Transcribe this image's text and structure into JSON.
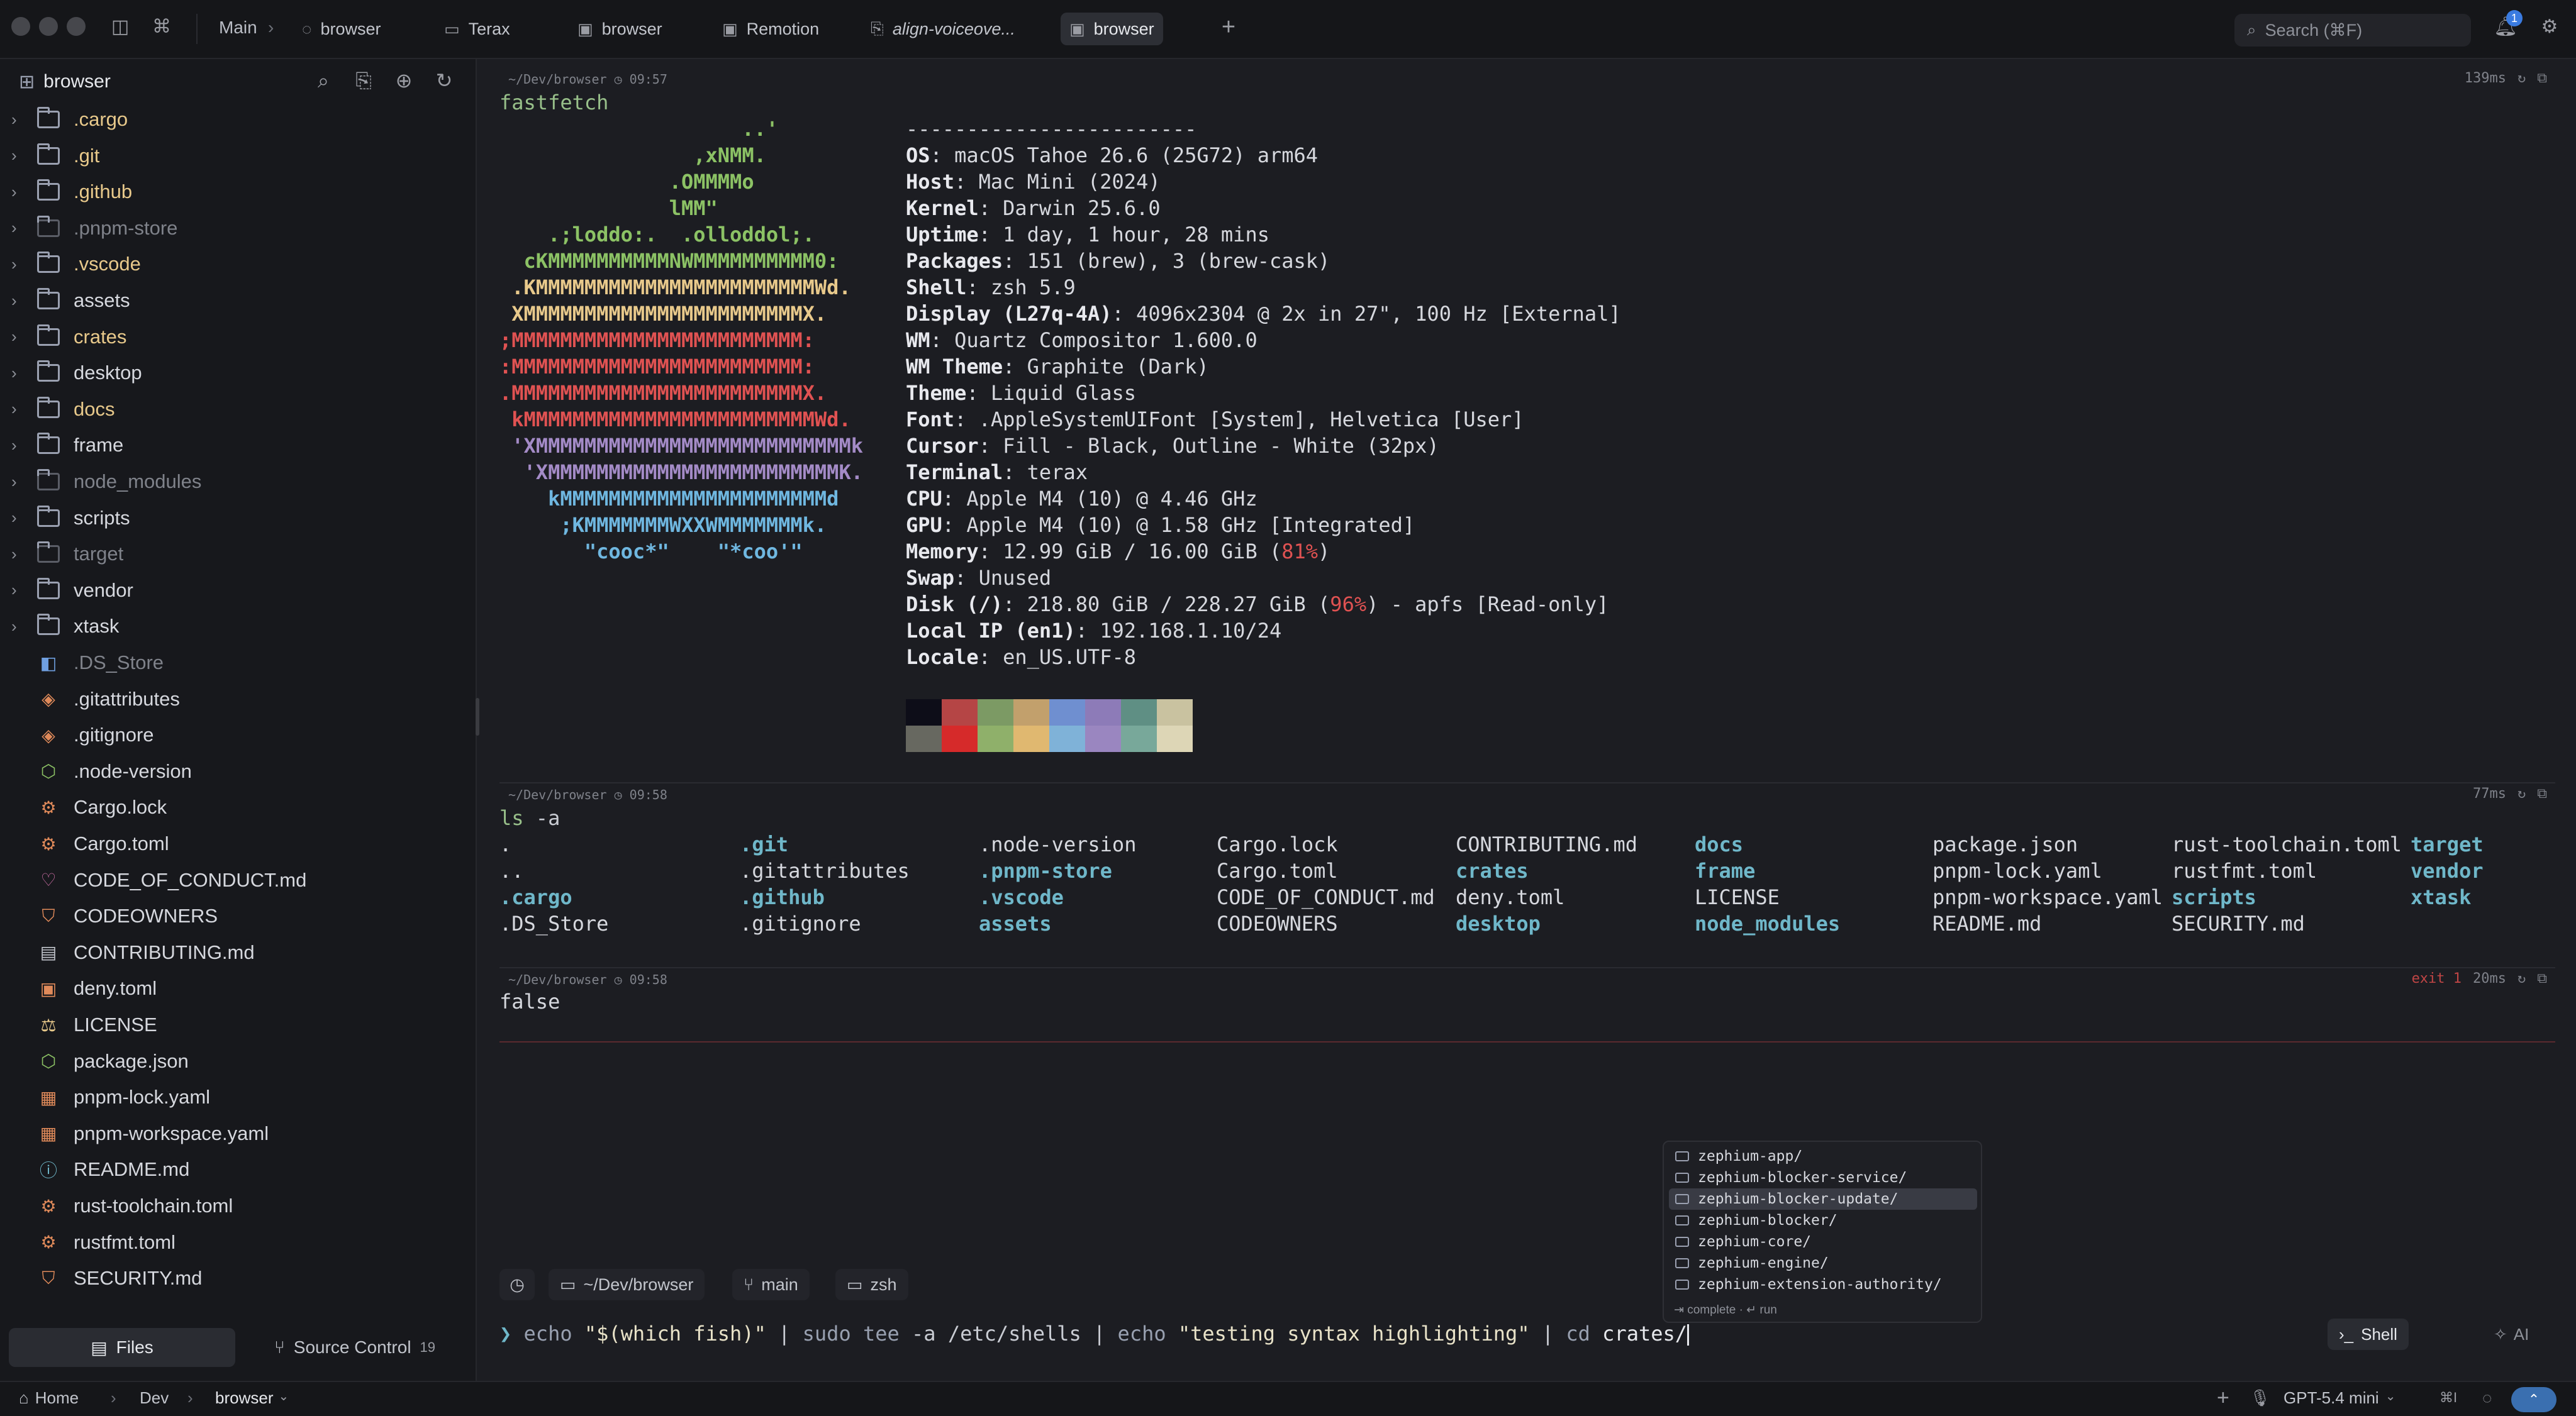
{
  "titlebar": {
    "breadcrumb": "Main",
    "tabs": [
      {
        "label": "browser",
        "icon": "chat-icon"
      },
      {
        "label": "Terax",
        "icon": "terminal-icon"
      },
      {
        "label": "browser",
        "icon": "browser-icon"
      },
      {
        "label": "Remotion",
        "icon": "browser-icon"
      },
      {
        "label": "align-voiceove...",
        "icon": "file-icon"
      },
      {
        "label": "browser",
        "icon": "browser-icon",
        "active": true
      }
    ],
    "search_placeholder": "Search (⌘F)",
    "notification_count": "1"
  },
  "sidebar": {
    "title": "browser",
    "items": [
      {
        "name": ".cargo",
        "kind": "folder",
        "color": "#e8c98b"
      },
      {
        "name": ".git",
        "kind": "folder",
        "color": "#e8c98b"
      },
      {
        "name": ".github",
        "kind": "folder",
        "color": "#e8c98b"
      },
      {
        "name": ".pnpm-store",
        "kind": "folder",
        "color": "#7f828a"
      },
      {
        "name": ".vscode",
        "kind": "folder",
        "color": "#e8c98b"
      },
      {
        "name": "assets",
        "kind": "folder",
        "color": "#d6d8de"
      },
      {
        "name": "crates",
        "kind": "folder",
        "color": "#e8c98b"
      },
      {
        "name": "desktop",
        "kind": "folder",
        "color": "#d6d8de"
      },
      {
        "name": "docs",
        "kind": "folder",
        "color": "#e8c98b"
      },
      {
        "name": "frame",
        "kind": "folder",
        "color": "#d6d8de"
      },
      {
        "name": "node_modules",
        "kind": "folder",
        "color": "#7f828a"
      },
      {
        "name": "scripts",
        "kind": "folder",
        "color": "#d6d8de"
      },
      {
        "name": "target",
        "kind": "folder",
        "color": "#7f828a"
      },
      {
        "name": "vendor",
        "kind": "folder",
        "color": "#d6d8de"
      },
      {
        "name": "xtask",
        "kind": "folder",
        "color": "#d6d8de"
      },
      {
        "name": ".DS_Store",
        "kind": "file",
        "color": "#7f828a",
        "icon": "◧",
        "icolor": "#6f9fe0"
      },
      {
        "name": ".gitattributes",
        "kind": "file",
        "color": "#d6d8de",
        "icon": "◈",
        "icolor": "#e08a5a"
      },
      {
        "name": ".gitignore",
        "kind": "file",
        "color": "#d6d8de",
        "icon": "◈",
        "icolor": "#e08a5a"
      },
      {
        "name": ".node-version",
        "kind": "file",
        "color": "#d6d8de",
        "icon": "⬡",
        "icolor": "#8cc265"
      },
      {
        "name": "Cargo.lock",
        "kind": "file",
        "color": "#d6d8de",
        "icon": "⚙",
        "icolor": "#e08a5a"
      },
      {
        "name": "Cargo.toml",
        "kind": "file",
        "color": "#d6d8de",
        "icon": "⚙",
        "icolor": "#e08a5a"
      },
      {
        "name": "CODE_OF_CONDUCT.md",
        "kind": "file",
        "color": "#d6d8de",
        "icon": "♡",
        "icolor": "#d070a8"
      },
      {
        "name": "CODEOWNERS",
        "kind": "file",
        "color": "#d6d8de",
        "icon": "⛉",
        "icolor": "#e08a5a"
      },
      {
        "name": "CONTRIBUTING.md",
        "kind": "file",
        "color": "#d6d8de",
        "icon": "▤",
        "icolor": "#c2c5cc"
      },
      {
        "name": "deny.toml",
        "kind": "file",
        "color": "#d6d8de",
        "icon": "▣",
        "icolor": "#e08a5a"
      },
      {
        "name": "LICENSE",
        "kind": "file",
        "color": "#d6d8de",
        "icon": "⚖",
        "icolor": "#e8c98b"
      },
      {
        "name": "package.json",
        "kind": "file",
        "color": "#d6d8de",
        "icon": "⬡",
        "icolor": "#8cc265"
      },
      {
        "name": "pnpm-lock.yaml",
        "kind": "file",
        "color": "#d6d8de",
        "icon": "▦",
        "icolor": "#e08a5a"
      },
      {
        "name": "pnpm-workspace.yaml",
        "kind": "file",
        "color": "#d6d8de",
        "icon": "▦",
        "icolor": "#e08a5a"
      },
      {
        "name": "README.md",
        "kind": "file",
        "color": "#d6d8de",
        "icon": "ⓘ",
        "icolor": "#6fb7c9"
      },
      {
        "name": "rust-toolchain.toml",
        "kind": "file",
        "color": "#d6d8de",
        "icon": "⚙",
        "icolor": "#e08a5a"
      },
      {
        "name": "rustfmt.toml",
        "kind": "file",
        "color": "#d6d8de",
        "icon": "⚙",
        "icolor": "#e08a5a"
      },
      {
        "name": "SECURITY.md",
        "kind": "file",
        "color": "#d6d8de",
        "icon": "⛉",
        "icolor": "#e08a5a"
      }
    ],
    "files_tab": "Files",
    "source_control_tab": "Source Control",
    "source_control_count": "19"
  },
  "block1": {
    "path": "~/Dev/browser",
    "time": "09:57",
    "duration": "139ms",
    "command": "fastfetch",
    "logo": [
      {
        "text": "                    ..'",
        "color": "#8cc265"
      },
      {
        "text": "                ,xNMM.",
        "color": "#8cc265"
      },
      {
        "text": "              .OMMMMo",
        "color": "#8cc265"
      },
      {
        "text": "              lMM\"",
        "color": "#8cc265"
      },
      {
        "text": "    .;loddo:.  .olloddol;.",
        "color": "#8cc265"
      },
      {
        "text": "  cKMMMMMMMMMMNWMMMMMMMMMM0:",
        "color": "#8cc265"
      },
      {
        "text": " .KMMMMMMMMMMMMMMMMMMMMMMMWd.",
        "color": "#e8c98b"
      },
      {
        "text": " XMMMMMMMMMMMMMMMMMMMMMMMX.",
        "color": "#e8c98b"
      },
      {
        "text": ";MMMMMMMMMMMMMMMMMMMMMMMM:",
        "color": "#e05252"
      },
      {
        "text": ":MMMMMMMMMMMMMMMMMMMMMMMM:",
        "color": "#e05252"
      },
      {
        "text": ".MMMMMMMMMMMMMMMMMMMMMMMMX.",
        "color": "#e05252"
      },
      {
        "text": " kMMMMMMMMMMMMMMMMMMMMMMMMWd.",
        "color": "#e05252"
      },
      {
        "text": " 'XMMMMMMMMMMMMMMMMMMMMMMMMMMk",
        "color": "#a48bc7"
      },
      {
        "text": "  'XMMMMMMMMMMMMMMMMMMMMMMMMK.",
        "color": "#a48bc7"
      },
      {
        "text": "    kMMMMMMMMMMMMMMMMMMMMMMd",
        "color": "#6fb7e0"
      },
      {
        "text": "     ;KMMMMMMMWXXWMMMMMMMk.",
        "color": "#6fb7e0"
      },
      {
        "text": "       \"cooc*\"    \"*coo'\"",
        "color": "#6fb7e0"
      }
    ],
    "info": [
      {
        "label": "",
        "value": "------------------------"
      },
      {
        "label": "OS",
        "value": "macOS Tahoe 26.6 (25G72) arm64"
      },
      {
        "label": "Host",
        "value": "Mac Mini (2024)"
      },
      {
        "label": "Kernel",
        "value": "Darwin 25.6.0"
      },
      {
        "label": "Uptime",
        "value": "1 day, 1 hour, 28 mins"
      },
      {
        "label": "Packages",
        "value": "151 (brew), 3 (brew-cask)"
      },
      {
        "label": "Shell",
        "value": "zsh 5.9"
      },
      {
        "label": "Display (L27q-4A)",
        "value": "4096x2304 @ 2x in 27\", 100 Hz [External]"
      },
      {
        "label": "WM",
        "value": "Quartz Compositor 1.600.0"
      },
      {
        "label": "WM Theme",
        "value": "Graphite (Dark)"
      },
      {
        "label": "Theme",
        "value": "Liquid Glass"
      },
      {
        "label": "Font",
        "value": ".AppleSystemUIFont [System], Helvetica [User]"
      },
      {
        "label": "Cursor",
        "value": "Fill - Black, Outline - White (32px)"
      },
      {
        "label": "Terminal",
        "value": "terax"
      },
      {
        "label": "CPU",
        "value": "Apple M4 (10) @ 4.46 GHz"
      },
      {
        "label": "GPU",
        "value": "Apple M4 (10) @ 1.58 GHz [Integrated]"
      },
      {
        "label": "Memory",
        "value": "12.99 GiB / 16.00 GiB (",
        "highlight": "81%",
        "tail": ")"
      },
      {
        "label": "Swap",
        "value": "Unused"
      },
      {
        "label": "Disk (/)",
        "value": "218.80 GiB / 228.27 GiB (",
        "highlight": "96%",
        "tail": ") - apfs [Read-only]"
      },
      {
        "label": "Local IP (en1)",
        "value": "192.168.1.10/24"
      },
      {
        "label": "Locale",
        "value": "en_US.UTF-8"
      }
    ],
    "palette_top": [
      "#0d0d18",
      "#b54545",
      "#7c9a64",
      "#c2a06c",
      "#6f8fd0",
      "#8d7bb8",
      "#5f8f84",
      "#c9c2a0"
    ],
    "palette_bottom": [
      "#676860",
      "#d62a2a",
      "#8fb06a",
      "#e0b870",
      "#7fb2d8",
      "#9a86c0",
      "#78a89a",
      "#ddd6b6"
    ]
  },
  "block2": {
    "path": "~/Dev/browser",
    "time": "09:58",
    "duration": "77ms",
    "command": "ls",
    "args": " -a",
    "columns": [
      [
        {
          "t": "."
        },
        {
          "t": ".."
        },
        {
          "t": ".cargo",
          "d": true
        },
        {
          "t": ".DS_Store"
        }
      ],
      [
        {
          "t": ".git",
          "d": true
        },
        {
          "t": ".gitattributes"
        },
        {
          "t": ".github",
          "d": true
        },
        {
          "t": ".gitignore"
        }
      ],
      [
        {
          "t": ".node-version"
        },
        {
          "t": ".pnpm-store",
          "d": true
        },
        {
          "t": ".vscode",
          "d": true
        },
        {
          "t": "assets",
          "d": true
        }
      ],
      [
        {
          "t": "Cargo.lock"
        },
        {
          "t": "Cargo.toml"
        },
        {
          "t": "CODE_OF_CONDUCT.md"
        },
        {
          "t": "CODEOWNERS"
        }
      ],
      [
        {
          "t": "CONTRIBUTING.md"
        },
        {
          "t": "crates",
          "d": true
        },
        {
          "t": "deny.toml"
        },
        {
          "t": "desktop",
          "d": true
        }
      ],
      [
        {
          "t": "docs",
          "d": true
        },
        {
          "t": "frame",
          "d": true
        },
        {
          "t": "LICENSE"
        },
        {
          "t": "node_modules",
          "d": true
        }
      ],
      [
        {
          "t": "package.json"
        },
        {
          "t": "pnpm-lock.yaml"
        },
        {
          "t": "pnpm-workspace.yaml"
        },
        {
          "t": "README.md"
        }
      ],
      [
        {
          "t": "rust-toolchain.toml"
        },
        {
          "t": "rustfmt.toml"
        },
        {
          "t": "scripts",
          "d": true
        },
        {
          "t": "SECURITY.md"
        }
      ],
      [
        {
          "t": "target",
          "d": true
        },
        {
          "t": "vendor",
          "d": true
        },
        {
          "t": "xtask",
          "d": true
        }
      ]
    ]
  },
  "block3": {
    "path": "~/Dev/browser",
    "time": "09:58",
    "exit": "exit 1",
    "duration": "20ms",
    "output": "false"
  },
  "suggest": {
    "items": [
      "zephium-app/",
      "zephium-blocker-service/",
      "zephium-blocker-update/",
      "zephium-blocker/",
      "zephium-core/",
      "zephium-engine/",
      "zephium-extension-authority/"
    ],
    "selected_index": 2,
    "hint": "⇥ complete · ↵ run"
  },
  "chips": {
    "path": "~/Dev/browser",
    "branch": "main",
    "shell": "zsh"
  },
  "prompt": {
    "symbol": "❯",
    "parts": [
      {
        "t": " echo ",
        "c": "#98a0b0"
      },
      {
        "t": "\"$(which fish)\"",
        "c": "#e8e2c8"
      },
      {
        "t": " | ",
        "c": "#c9ccd3"
      },
      {
        "t": "sudo tee",
        "c": "#98a0b0"
      },
      {
        "t": " -a /etc/shells ",
        "c": "#c9ccd3"
      },
      {
        "t": "| ",
        "c": "#c9ccd3"
      },
      {
        "t": "echo ",
        "c": "#98a0b0"
      },
      {
        "t": "\"testing syntax highlighting\"",
        "c": "#e8e2c8"
      },
      {
        "t": " | ",
        "c": "#c9ccd3"
      },
      {
        "t": "cd ",
        "c": "#98a0b0"
      },
      {
        "t": "crates/",
        "c": "#e6e8ec"
      }
    ],
    "mode_shell": "Shell",
    "mode_ai": "AI"
  },
  "statusbar": {
    "home": "Home",
    "dev": "Dev",
    "current": "browser",
    "model": "GPT-5.4 mini",
    "shortcut": "⌘I"
  }
}
